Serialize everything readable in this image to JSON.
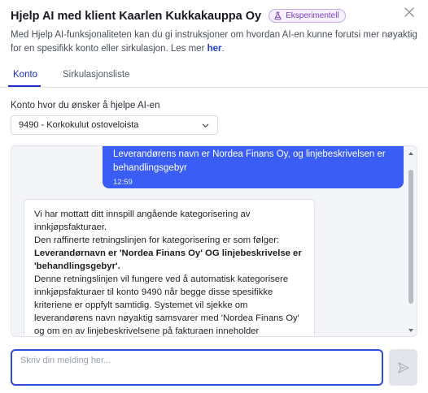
{
  "dialog": {
    "title": "Hjelp AI med klient Kaarlen Kukkakauppa Oy",
    "badge": "Eksperimentell",
    "description": "Med Hjelp AI-funksjonaliteten kan du gi instruksjoner om hvordan AI-en kunne forutsi mer nøyaktig for en spesifikk konto eller sirkulasjon. Les mer ",
    "description_link": "her",
    "description_end": "."
  },
  "tabs": [
    {
      "label": "Konto",
      "active": true
    },
    {
      "label": "Sirkulasjonsliste",
      "active": false
    }
  ],
  "account_field": {
    "label": "Konto hvor du ønsker å hjelpe AI-en",
    "selected": "9490 - Korkokulut ostoveloista"
  },
  "chat": {
    "user_message": {
      "text": "Leverandørens navn er Nordea Finans Oy, og linjebeskrivelsen er behandlingsgebyr",
      "time": "12:59"
    },
    "ai_message": {
      "p1": "Vi har mottatt ditt innspill angående kategorisering av innkjøpsfakturaer.",
      "p2": "Den raffinerte retningslinjen for kategorisering er som følger:",
      "p3_bold": "Leverandørnavn er 'Nordea Finans Oy' OG linjebeskrivelse er 'behandlingsgebyr'.",
      "p4": "Denne retningslinjen vil fungere ved å automatisk kategorisere innkjøpsfakturaer til konto 9490 når begge disse spesifikke kriteriene er oppfylt samtidig. Systemet vil sjekke om leverandørens navn nøyaktig samsvarer med 'Nordea Finans Oy' og om en av linjebeskrivelsene på fakturaen inneholder 'behandlingsgebyr'."
    }
  },
  "composer": {
    "placeholder": "Skriv din melding her..."
  },
  "icons": {
    "badge": "flask-icon",
    "close": "close-icon",
    "select": "chevron-down-icon",
    "send": "send-icon"
  },
  "colors": {
    "accent": "#3a5ef5",
    "badge_text": "#7a3fc9",
    "link": "#1f3fd6"
  }
}
